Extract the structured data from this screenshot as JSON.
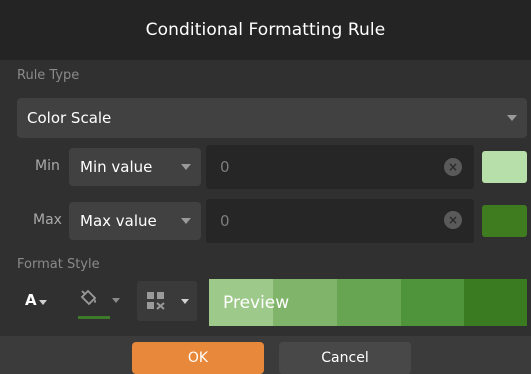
{
  "dialog": {
    "title": "Conditional Formatting Rule"
  },
  "rule_type": {
    "label": "Rule Type",
    "selected": "Color Scale"
  },
  "min_row": {
    "label": "Min",
    "type": "Min value",
    "value": "0",
    "color": "#b7dfa9"
  },
  "max_row": {
    "label": "Max",
    "type": "Max value",
    "value": "0",
    "color": "#3e7c1f"
  },
  "format_style": {
    "label": "Format Style",
    "font_color_glyph": "A",
    "fill_underline_color": "#3f7a2a",
    "preview_label": "Preview",
    "preview_colors": [
      "#b6dba7",
      "#9dca8a",
      "#7fb46a",
      "#67a553",
      "#4f933a",
      "#3a7b22"
    ]
  },
  "buttons": {
    "ok": "OK",
    "cancel": "Cancel"
  },
  "colors": {
    "ok_button": "#e8883a",
    "cancel_button": "#484848"
  }
}
